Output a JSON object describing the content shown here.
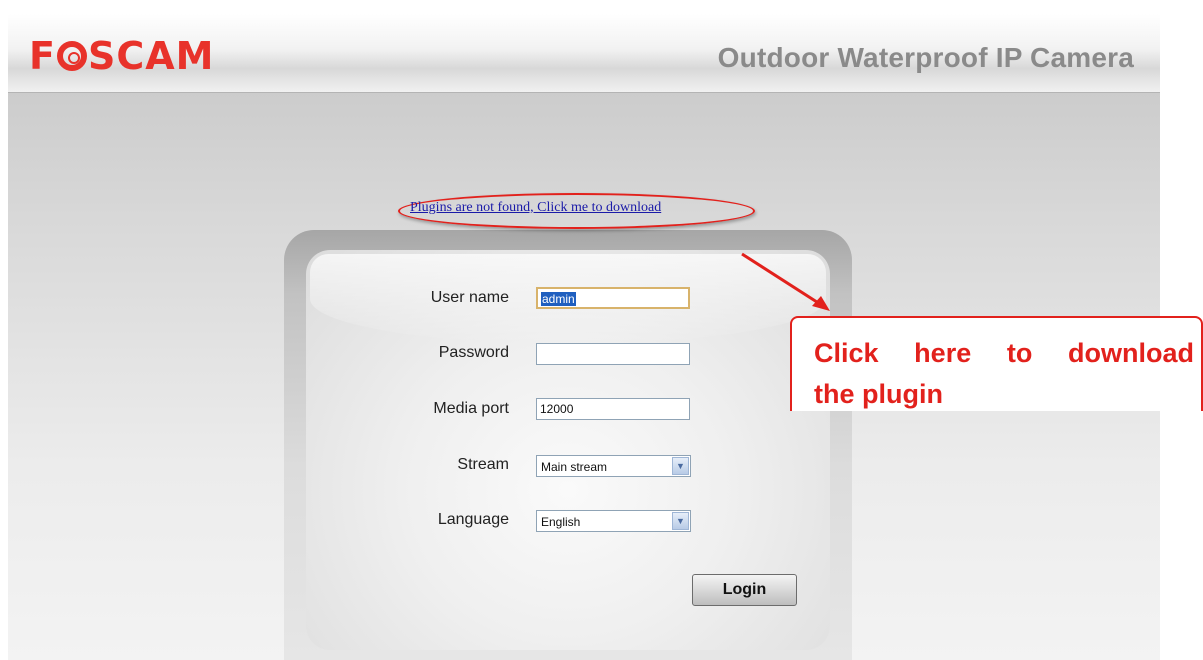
{
  "header": {
    "logo_pre": "F",
    "logo_post": "SCAM",
    "title": "Outdoor Waterproof IP Camera"
  },
  "plugin_link": "Plugins are not found, Click me to download",
  "form": {
    "username_label": "User name",
    "username_value": "admin",
    "password_label": "Password",
    "password_value": "",
    "mediaport_label": "Media port",
    "mediaport_value": "12000",
    "stream_label": "Stream",
    "stream_value": "Main stream",
    "language_label": "Language",
    "language_value": "English",
    "login_label": "Login"
  },
  "callout": {
    "line1": "Click here to download",
    "line2": "the plugin"
  },
  "colors": {
    "brand_red": "#e8322a",
    "annotation_red": "#e2211c",
    "link_blue": "#1a1aa8"
  }
}
